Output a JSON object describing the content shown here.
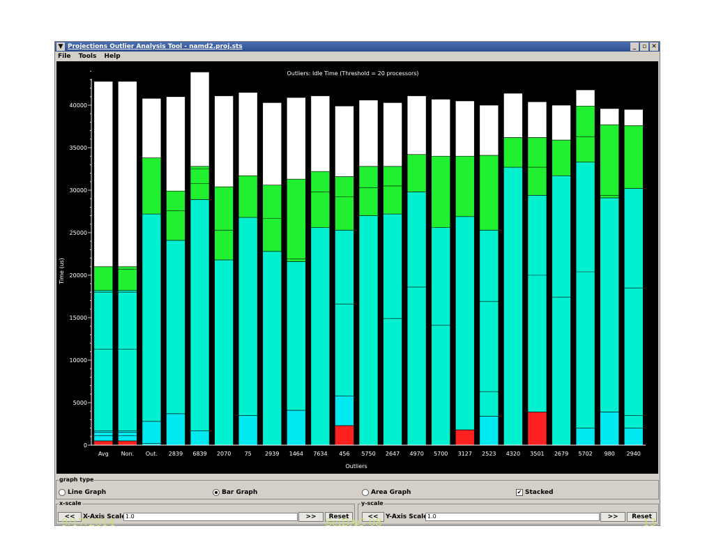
{
  "window": {
    "title": "Projections Outlier Analysis Tool - namd2.proj.sts",
    "buttons": [
      "_",
      "▫",
      "✕"
    ]
  },
  "menu": {
    "items": [
      "File",
      "Tools",
      "Help"
    ]
  },
  "chart_data": {
    "type": "bar",
    "stacked": true,
    "title": "Outliers: Idle Time (Threshold = 20 processors)",
    "xlabel": "Outliers",
    "ylabel": "Time (us)",
    "ylim": [
      0,
      45000
    ],
    "yticks": [
      0,
      5000,
      10000,
      15000,
      20000,
      25000,
      30000,
      35000,
      40000
    ],
    "categories": [
      "Avg",
      "Non.",
      "Out.",
      "2839",
      "6839",
      "2070",
      "75",
      "2939",
      "1464",
      "7634",
      "456",
      "5750",
      "2647",
      "4970",
      "5700",
      "3127",
      "2523",
      "4320",
      "3501",
      "2679",
      "5702",
      "980",
      "2940"
    ],
    "segment_colors": [
      "#ff2020",
      "#00e8f0",
      "#00f0d0",
      "#20f030",
      "#ffffff"
    ],
    "bars": [
      {
        "ends": [
          500,
          1700,
          18200,
          21000,
          42800
        ],
        "dividers": [
          1100,
          1500,
          11300,
          18000
        ]
      },
      {
        "ends": [
          500,
          1700,
          18200,
          21000,
          42800
        ],
        "dividers": [
          1100,
          1500,
          11300,
          18000,
          20700
        ]
      },
      {
        "ends": [
          0,
          2800,
          27200,
          33800,
          40800
        ],
        "dividers": [
          200
        ]
      },
      {
        "ends": [
          0,
          3700,
          24100,
          29900,
          41000
        ],
        "dividers": [
          27600
        ]
      },
      {
        "ends": [
          0,
          1700,
          28900,
          32800,
          43900
        ],
        "dividers": [
          30800,
          32500
        ]
      },
      {
        "ends": [
          0,
          0,
          21800,
          30400,
          41100
        ],
        "dividers": [
          25300
        ]
      },
      {
        "ends": [
          0,
          3500,
          26800,
          31700,
          41500
        ],
        "dividers": []
      },
      {
        "ends": [
          0,
          0,
          22800,
          30600,
          40300
        ],
        "dividers": [
          26700
        ]
      },
      {
        "ends": [
          0,
          4100,
          21600,
          31300,
          40900
        ],
        "dividers": [
          21900
        ]
      },
      {
        "ends": [
          0,
          0,
          25600,
          32200,
          41100
        ],
        "dividers": [
          29800
        ]
      },
      {
        "ends": [
          2300,
          5800,
          25300,
          31600,
          39900
        ],
        "dividers": [
          16600,
          29200
        ]
      },
      {
        "ends": [
          0,
          0,
          27000,
          32800,
          40600
        ],
        "dividers": [
          30300
        ]
      },
      {
        "ends": [
          0,
          0,
          27200,
          32800,
          40300
        ],
        "dividers": [
          14900,
          30500
        ]
      },
      {
        "ends": [
          0,
          0,
          29800,
          34200,
          41100
        ],
        "dividers": [
          18600
        ]
      },
      {
        "ends": [
          0,
          0,
          25600,
          34000,
          40700
        ],
        "dividers": [
          14100
        ]
      },
      {
        "ends": [
          1800,
          1800,
          26900,
          34000,
          40500
        ],
        "dividers": []
      },
      {
        "ends": [
          0,
          3400,
          25300,
          34100,
          40000
        ],
        "dividers": [
          6300,
          16900
        ]
      },
      {
        "ends": [
          0,
          0,
          32700,
          36200,
          41400
        ],
        "dividers": []
      },
      {
        "ends": [
          3900,
          3900,
          29400,
          36200,
          40400
        ],
        "dividers": [
          20000,
          32700
        ]
      },
      {
        "ends": [
          0,
          0,
          31700,
          35900,
          40000
        ],
        "dividers": [
          17400
        ]
      },
      {
        "ends": [
          0,
          2000,
          33300,
          39900,
          41800
        ],
        "dividers": [
          20400,
          36300
        ]
      },
      {
        "ends": [
          0,
          3900,
          29100,
          37700,
          39600
        ],
        "dividers": [
          29400
        ]
      },
      {
        "ends": [
          0,
          2000,
          30200,
          37600,
          39500
        ],
        "dividers": [
          3500,
          18500
        ]
      }
    ]
  },
  "graph_type": {
    "title": "graph type",
    "line": "Line Graph",
    "bar": "Bar Graph",
    "area": "Area Graph",
    "stacked": "Stacked"
  },
  "x_scale": {
    "title": "x-scale",
    "prev": "<<",
    "label": "X-Axis Scale:",
    "value": "1.0",
    "next": ">>",
    "reset": "Reset"
  },
  "y_scale": {
    "title": "y-scale",
    "prev": "<<",
    "label": "Y-Axis Scale:",
    "value": "1.0",
    "next": ">>",
    "reset": "Reset"
  },
  "footer": {
    "date": "9/17/2014",
    "center": "SciDAC-08",
    "page": "13"
  }
}
